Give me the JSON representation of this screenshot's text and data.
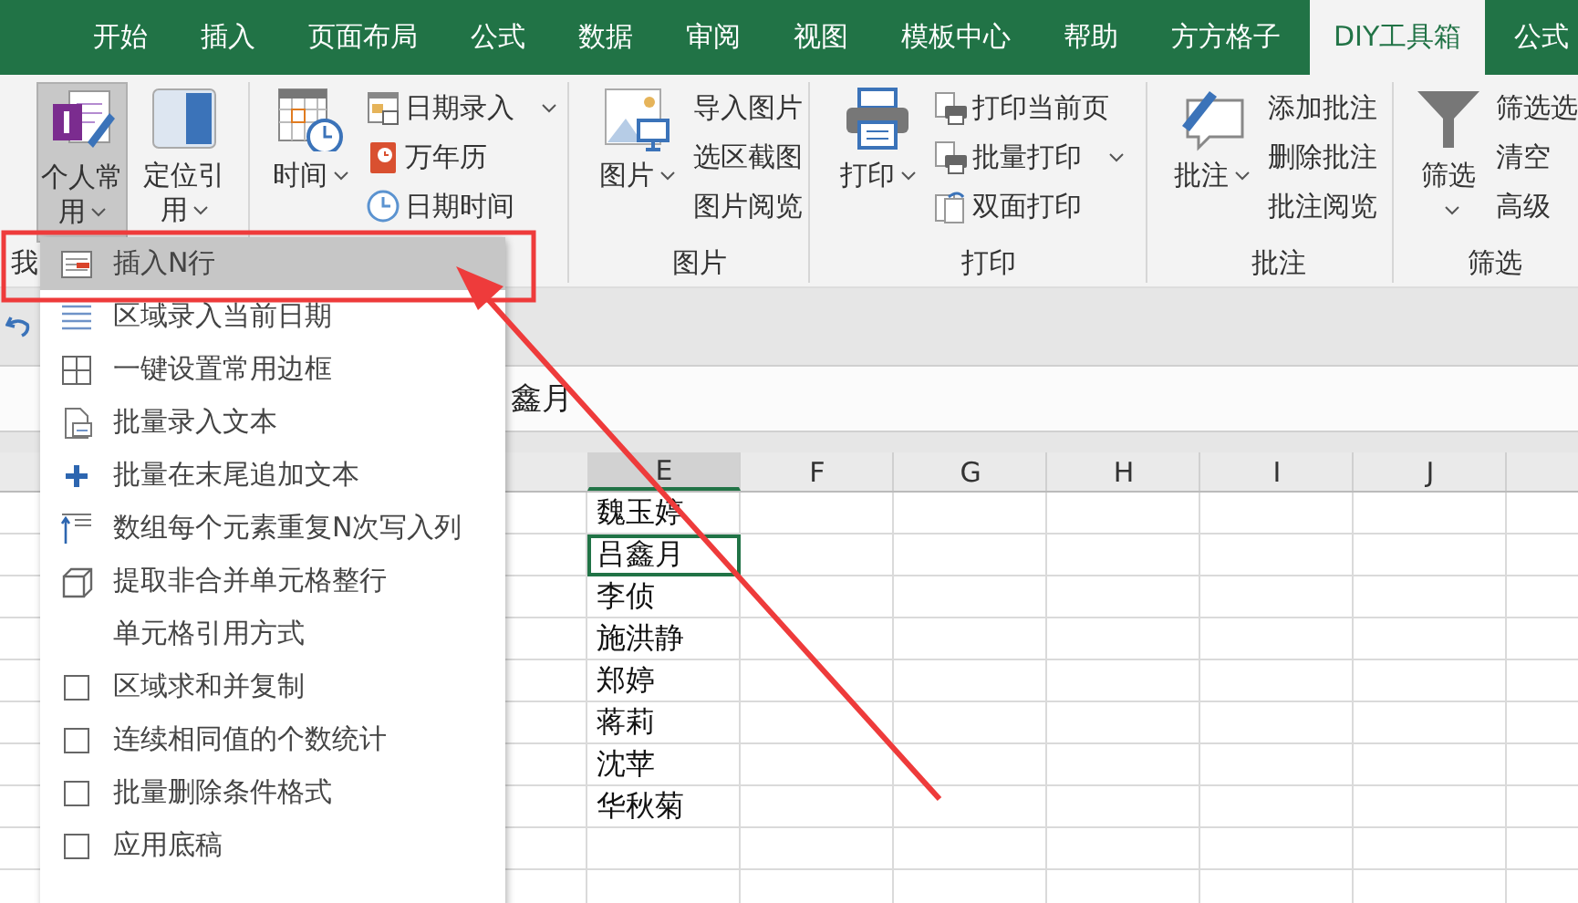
{
  "tabs": [
    {
      "label": "开始",
      "selected": false
    },
    {
      "label": "插入",
      "selected": false
    },
    {
      "label": "页面布局",
      "selected": false
    },
    {
      "label": "公式",
      "selected": false
    },
    {
      "label": "数据",
      "selected": false
    },
    {
      "label": "审阅",
      "selected": false
    },
    {
      "label": "视图",
      "selected": false
    },
    {
      "label": "模板中心",
      "selected": false
    },
    {
      "label": "帮助",
      "selected": false
    },
    {
      "label": "方方格子",
      "selected": false
    },
    {
      "label": "DIY工具箱",
      "selected": true
    },
    {
      "label": "公式",
      "selected": false
    }
  ],
  "ribbon": {
    "groups": [
      {
        "label": "我",
        "large": [
          {
            "label": "个人常用",
            "caret": true,
            "pressed": true
          },
          {
            "label": "定位引用",
            "caret": true,
            "pressed": false
          }
        ]
      },
      {
        "large": [
          {
            "label": "时间",
            "caret": true,
            "pressed": false
          }
        ],
        "small": [
          {
            "label": "日期录入",
            "caret": true
          },
          {
            "label": "万年历",
            "caret": false
          },
          {
            "label": "日期时间",
            "caret": false
          }
        ]
      },
      {
        "label": "图片",
        "large": [
          {
            "label": "图片",
            "caret": true,
            "pressed": false
          }
        ],
        "small": [
          {
            "label": "导入图片",
            "caret": false
          },
          {
            "label": "选区截图",
            "caret": false
          },
          {
            "label": "图片阅览",
            "caret": false
          }
        ]
      },
      {
        "label": "打印",
        "large": [
          {
            "label": "打印",
            "caret": true,
            "pressed": false
          }
        ],
        "small": [
          {
            "label": "打印当前页",
            "caret": false
          },
          {
            "label": "批量打印",
            "caret": true
          },
          {
            "label": "双面打印",
            "caret": false
          }
        ]
      },
      {
        "label": "批注",
        "large": [
          {
            "label": "批注",
            "caret": true,
            "pressed": false
          }
        ],
        "small": [
          {
            "label": "添加批注",
            "caret": false
          },
          {
            "label": "删除批注",
            "caret": false
          },
          {
            "label": "批注阅览",
            "caret": false
          }
        ]
      },
      {
        "label": "筛选",
        "large": [
          {
            "label": "筛选",
            "caret": true,
            "pressed": false
          }
        ],
        "small": [
          {
            "label": "筛选选",
            "caret": false
          },
          {
            "label": "清空",
            "caret": false
          },
          {
            "label": "高级",
            "caret": false
          }
        ]
      }
    ]
  },
  "formula_bar": {
    "value": "鑫月"
  },
  "sheet": {
    "columns": [
      {
        "label": "E",
        "selected": true
      },
      {
        "label": "F",
        "selected": false
      },
      {
        "label": "G",
        "selected": false
      },
      {
        "label": "H",
        "selected": false
      },
      {
        "label": "I",
        "selected": false
      },
      {
        "label": "J",
        "selected": false
      }
    ],
    "rows": [
      {
        "value": "魏玉婷",
        "selected": false
      },
      {
        "value": "吕鑫月",
        "selected": true
      },
      {
        "value": "李侦",
        "selected": false
      },
      {
        "value": "施洪静",
        "selected": false
      },
      {
        "value": "郑婷",
        "selected": false
      },
      {
        "value": "蒋莉",
        "selected": false
      },
      {
        "value": "沈苹",
        "selected": false
      },
      {
        "value": "华秋菊",
        "selected": false
      }
    ]
  },
  "menu": {
    "items": [
      {
        "label": "插入N行",
        "selected": true
      },
      {
        "label": "区域录入当前日期",
        "selected": false
      },
      {
        "label": "一键设置常用边框",
        "selected": false
      },
      {
        "label": "批量录入文本",
        "selected": false
      },
      {
        "label": "批量在末尾追加文本",
        "selected": false
      },
      {
        "label": "数组每个元素重复N次写入列",
        "selected": false
      },
      {
        "label": "提取非合并单元格整行",
        "selected": false
      },
      {
        "label": "单元格引用方式",
        "selected": false
      },
      {
        "label": "区域求和并复制",
        "selected": false
      },
      {
        "label": "连续相同值的个数统计",
        "selected": false
      },
      {
        "label": "批量删除条件格式",
        "selected": false
      },
      {
        "label": "应用底稿",
        "selected": false
      }
    ]
  }
}
